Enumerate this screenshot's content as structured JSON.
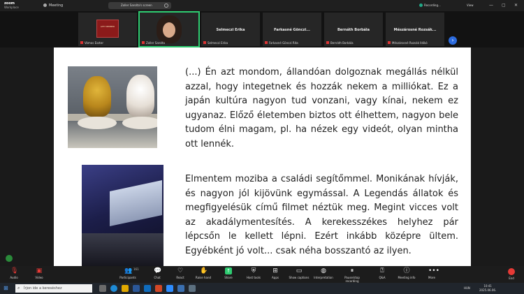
{
  "titlebar": {
    "brand": "zoom",
    "brand_sub": "Workplace",
    "meeting_label": "Meeting",
    "share_pill": "Zoller Sarolta's screen",
    "recording": "Recording...",
    "view": "View",
    "win_min": "—",
    "win_max": "▢",
    "win_close": "✕"
  },
  "participants": [
    {
      "name": "Vámos Eszter",
      "type": "logo",
      "logo_text": "LIFE MEMBER"
    },
    {
      "name": "Zoller Sarolta",
      "type": "video",
      "speaking": true
    },
    {
      "name": "Selmeczi Erika",
      "type": "name"
    },
    {
      "name": "Farkasné Gönczi Rita",
      "type": "name",
      "display": "Farkasné Gönczi..."
    },
    {
      "name": "Bernáth Borbála",
      "type": "name"
    },
    {
      "name": "Mészárosné Rozsák Ildikó",
      "type": "name",
      "display": "Mészárosné Rozsák..."
    }
  ],
  "next_page_icon": "chevron-right-icon",
  "slide": {
    "paragraph1": "(...) Én azt mondom, állandóan dolgoznak megállás nélkül azzal, hogy integetnek és hozzák nekem a milliókat. Ez a japán kultúra nagyon tud vonzani, vagy kínai, nekem ez ugyanaz. Előző életemben biztos ott élhettem, nagyon bele tudom élni magam, pl. ha nézek egy videót, olyan mintha ott lennék.",
    "paragraph2": "Elmentem moziba a családi segítőmmel. Monikának hívják, és nagyon jól kijövünk egymással. A Legendás állatok és megfigyelésük című filmet néztük meg. Megint vicces volt az akadálymentesítés. A kerekesszékes helyhez pár lépcsőn le kellett lépni. Ezért inkább középre ültem. Egyébként jó volt... csak néha bosszantó az ilyen."
  },
  "toolbar": {
    "audio": "Audio",
    "video": "Video",
    "participants": "Participants",
    "participants_count": "161",
    "chat": "Chat",
    "react": "React",
    "raise_hand": "Raise hand",
    "share": "Share",
    "host_tools": "Host tools",
    "apps": "Apps",
    "show_captions": "Show captions",
    "interpretation": "Interpretation",
    "pause_recording": "Pause/stop recording",
    "qa": "Q&A",
    "meeting_info": "Meeting info",
    "more": "More",
    "end": "End"
  },
  "taskbar": {
    "search_placeholder": "Írjon ide a kereséshez",
    "language": "HUN",
    "time": "10:41",
    "date": "2025.06.06."
  },
  "colors": {
    "accent_green": "#2ecc71",
    "mute_red": "#e53935",
    "zoom_blue": "#2d6cdf"
  }
}
